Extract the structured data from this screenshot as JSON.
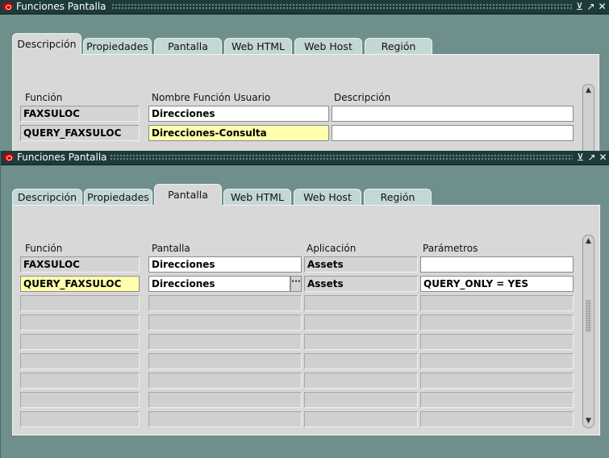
{
  "window_title": "Funciones Pantalla",
  "title_buttons": {
    "minimize": "⊻",
    "maximize": "↗",
    "close": "✕"
  },
  "tabs": [
    "Descripción",
    "Propiedades",
    "Pantalla",
    "Web HTML",
    "Web Host",
    "Región"
  ],
  "back_window": {
    "active_tab": "Descripción",
    "headers": [
      "Función",
      "Nombre Función Usuario",
      "Descripción"
    ],
    "rows": [
      {
        "funcion": "FAXSULOC",
        "nombre": "Direcciones",
        "descripcion": ""
      },
      {
        "funcion": "QUERY_FAXSULOC",
        "nombre": "Direcciones-Consulta",
        "descripcion": ""
      }
    ]
  },
  "front_window": {
    "active_tab": "Pantalla",
    "headers": [
      "Función",
      "Pantalla",
      "Aplicación",
      "Parámetros"
    ],
    "rows": [
      {
        "funcion": "FAXSULOC",
        "pantalla": "Direcciones",
        "aplicacion": "Assets",
        "parametros": ""
      },
      {
        "funcion": "QUERY_FAXSULOC",
        "pantalla": "Direcciones",
        "aplicacion": "Assets",
        "parametros": "QUERY_ONLY = YES"
      }
    ],
    "lov_button": "···"
  },
  "scroll_arrows": {
    "up": "▲",
    "down": "▼"
  }
}
